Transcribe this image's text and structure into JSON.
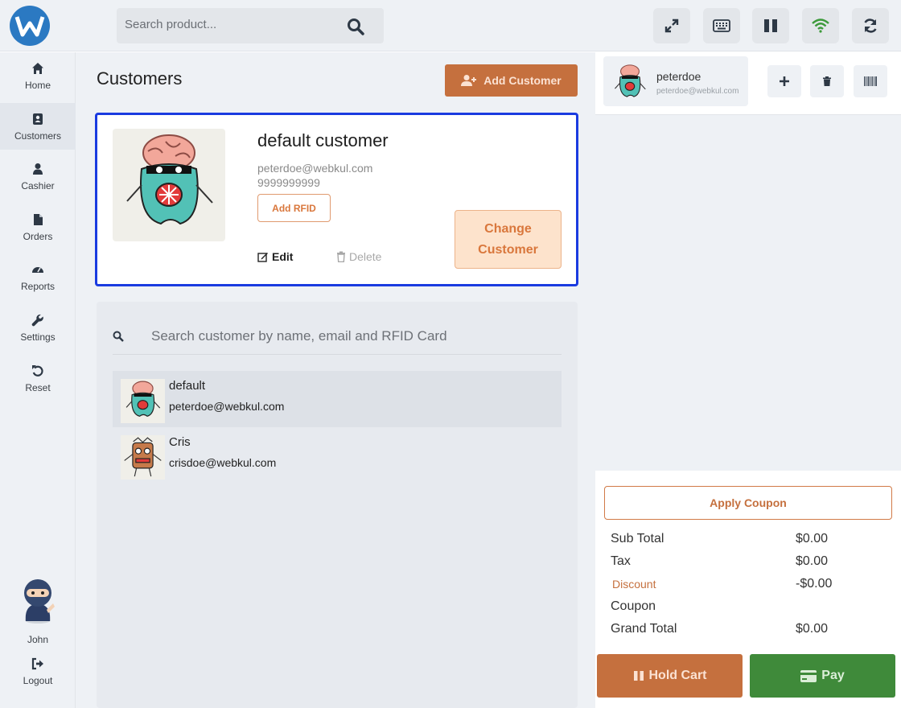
{
  "topbar": {
    "search_placeholder": "Search product...",
    "icons": [
      "expand-icon",
      "keyboard-icon",
      "pause-icon",
      "wifi-icon",
      "refresh-icon"
    ]
  },
  "sidebar": {
    "items": [
      {
        "label": "Home",
        "icon": "home-icon"
      },
      {
        "label": "Customers",
        "icon": "customers-icon",
        "active": true
      },
      {
        "label": "Cashier",
        "icon": "cashier-icon"
      },
      {
        "label": "Orders",
        "icon": "orders-icon"
      },
      {
        "label": "Reports",
        "icon": "reports-icon"
      },
      {
        "label": "Settings",
        "icon": "settings-icon"
      },
      {
        "label": "Reset",
        "icon": "reset-icon"
      }
    ],
    "user_name": "John",
    "logout_label": "Logout"
  },
  "main": {
    "title": "Customers",
    "add_customer_label": "Add Customer",
    "selected": {
      "name": "default customer",
      "email": "peterdoe@webkul.com",
      "phone": "9999999999",
      "add_rfid_label": "Add RFID",
      "edit_label": "Edit",
      "delete_label": "Delete",
      "change_label": "Change Customer"
    },
    "list_search_placeholder": "Search customer by name, email and RFID Card",
    "customers": [
      {
        "name": "default",
        "email": "peterdoe@webkul.com"
      },
      {
        "name": "Cris",
        "email": "crisdoe@webkul.com"
      }
    ]
  },
  "cart": {
    "customer_name": "peterdoe",
    "customer_email": "peterdoe@webkul.com",
    "apply_coupon_label": "Apply Coupon",
    "totals": [
      {
        "label": "Sub Total",
        "value": "$0.00"
      },
      {
        "label": "Tax",
        "value": "$0.00"
      },
      {
        "label": "Discount",
        "value": "-$0.00"
      },
      {
        "label": "Coupon",
        "value": ""
      },
      {
        "label": "Grand Total",
        "value": "$0.00"
      }
    ],
    "hold_label": "Hold Cart",
    "pay_label": "Pay"
  },
  "colors": {
    "accent_orange": "#c5703e",
    "pay_green": "#3f8a3a",
    "selected_border": "#1a3be0",
    "logo_blue": "#2b79c2"
  }
}
